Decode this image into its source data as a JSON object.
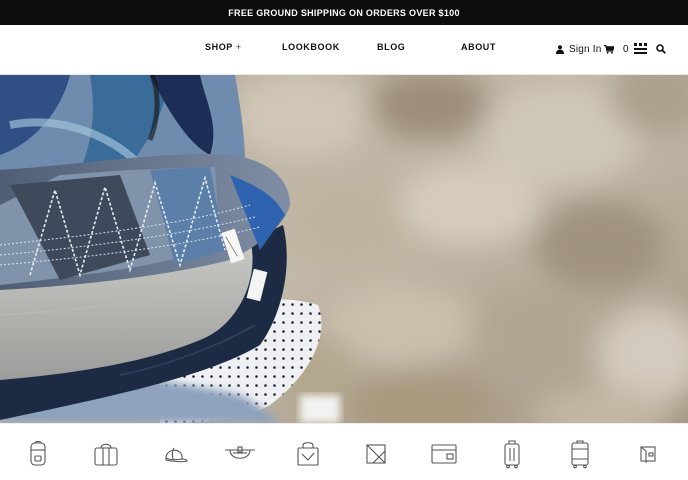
{
  "promo": {
    "text": "FREE GROUND SHIPPING ON ORDERS OVER $100"
  },
  "nav": {
    "shop_label": "SHOP",
    "shop_plus": "+",
    "lookbook_label": "LOOKBOOK",
    "blog_label": "BLOG",
    "about_label": "ABOUT"
  },
  "utility": {
    "sign_in_label": "Sign In",
    "cart_count": "0",
    "icons": [
      "user-icon",
      "cart-icon",
      "brand-menu-icon",
      "search-icon"
    ]
  },
  "hero": {
    "image": "stacked-bucket-hats-photo"
  },
  "categories": {
    "icons": [
      "backpack-icon",
      "duffle-bag-icon",
      "cap-icon",
      "hip-pack-icon",
      "tote-bag-icon",
      "pouch-icon",
      "folio-icon",
      "carry-on-luggage-icon",
      "large-luggage-icon",
      "wallet-icon"
    ]
  },
  "colors": {
    "promo_bg": "#0d0d0d",
    "text": "#111111",
    "icon_stroke": "#555555"
  }
}
